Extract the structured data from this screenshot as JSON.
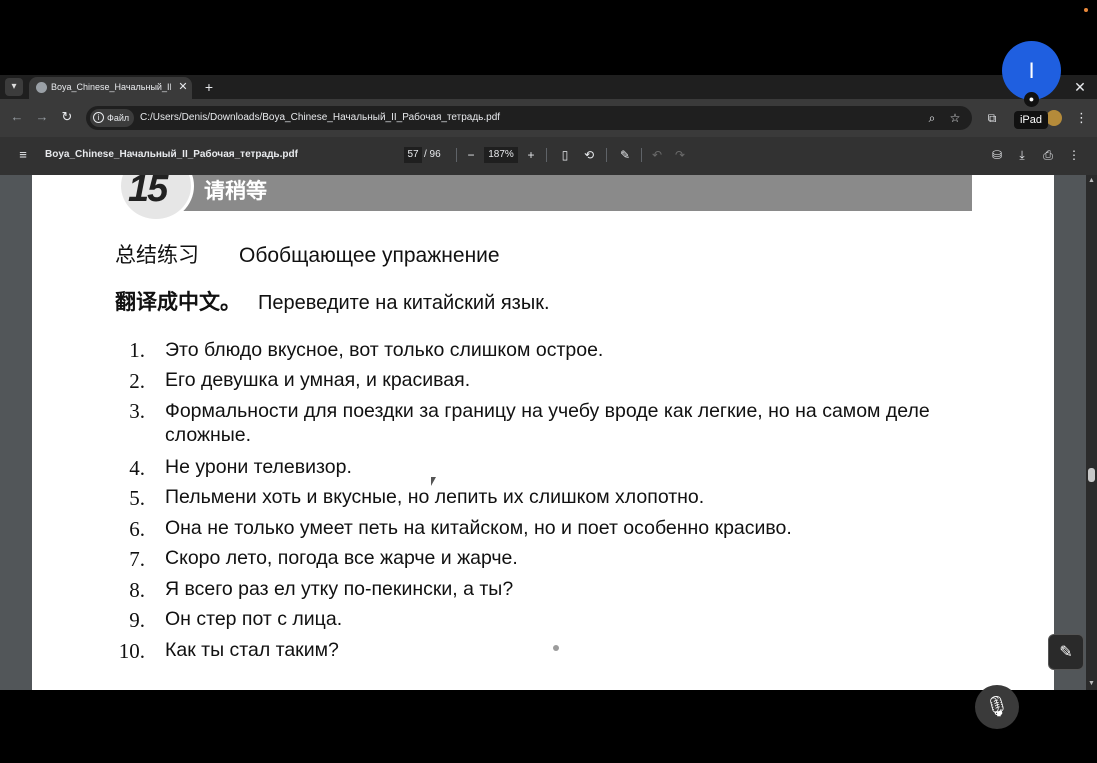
{
  "browser": {
    "tab_title": "Boya_Chinese_Начальный_II_Р",
    "tab_close": "✕",
    "new_tab": "+",
    "window_close": "✕",
    "site_chip_label": "Файл",
    "url": "C:/Users/Denis/Downloads/Boya_Chinese_Начальный_II_Рабочая_тетрадь.pdf"
  },
  "pdf_toolbar": {
    "title": "Boya_Chinese_Начальный_II_Рабочая_тетрадь.pdf",
    "current_page": "57",
    "total_pages": "/ 96",
    "zoom": "187%"
  },
  "page": {
    "lesson_number": "15",
    "lesson_title": "请稍等",
    "section_zh": "总结练习",
    "section_ru": "Обобщающее упражнение",
    "task_zh": "翻译成中文。",
    "task_ru": "Переведите на китайский язык.",
    "exercises": [
      {
        "num": "1.",
        "text": "Это блюдо вкусное, вот только слишком острое."
      },
      {
        "num": "2.",
        "text": "Его девушка и умная, и красивая."
      },
      {
        "num": "3.",
        "text": "Формальности для поездки за границу на учебу вроде как легкие, но на самом деле сложные."
      },
      {
        "num": "4.",
        "text": "Не урони телевизор."
      },
      {
        "num": "5.",
        "text": "Пельмени хоть и вкусные, но лепить их слишком хлопотно."
      },
      {
        "num": "6.",
        "text": "Она не только умеет петь на китайском, но и поет особенно красиво."
      },
      {
        "num": "7.",
        "text": "Скоро лето, погода все жарче и жарче."
      },
      {
        "num": "8.",
        "text": "Я всего раз ел утку по-пекински, а ты?"
      },
      {
        "num": "9.",
        "text": "Он стер пот с лица."
      },
      {
        "num": "10.",
        "text": "Как ты стал таким?"
      }
    ]
  },
  "overlay": {
    "avatar_initial": "I",
    "device_label": "iPad"
  },
  "colors": {
    "avatar": "#1f5fe0",
    "banner": "#8a8a8a",
    "viewer_bg": "#525659"
  }
}
